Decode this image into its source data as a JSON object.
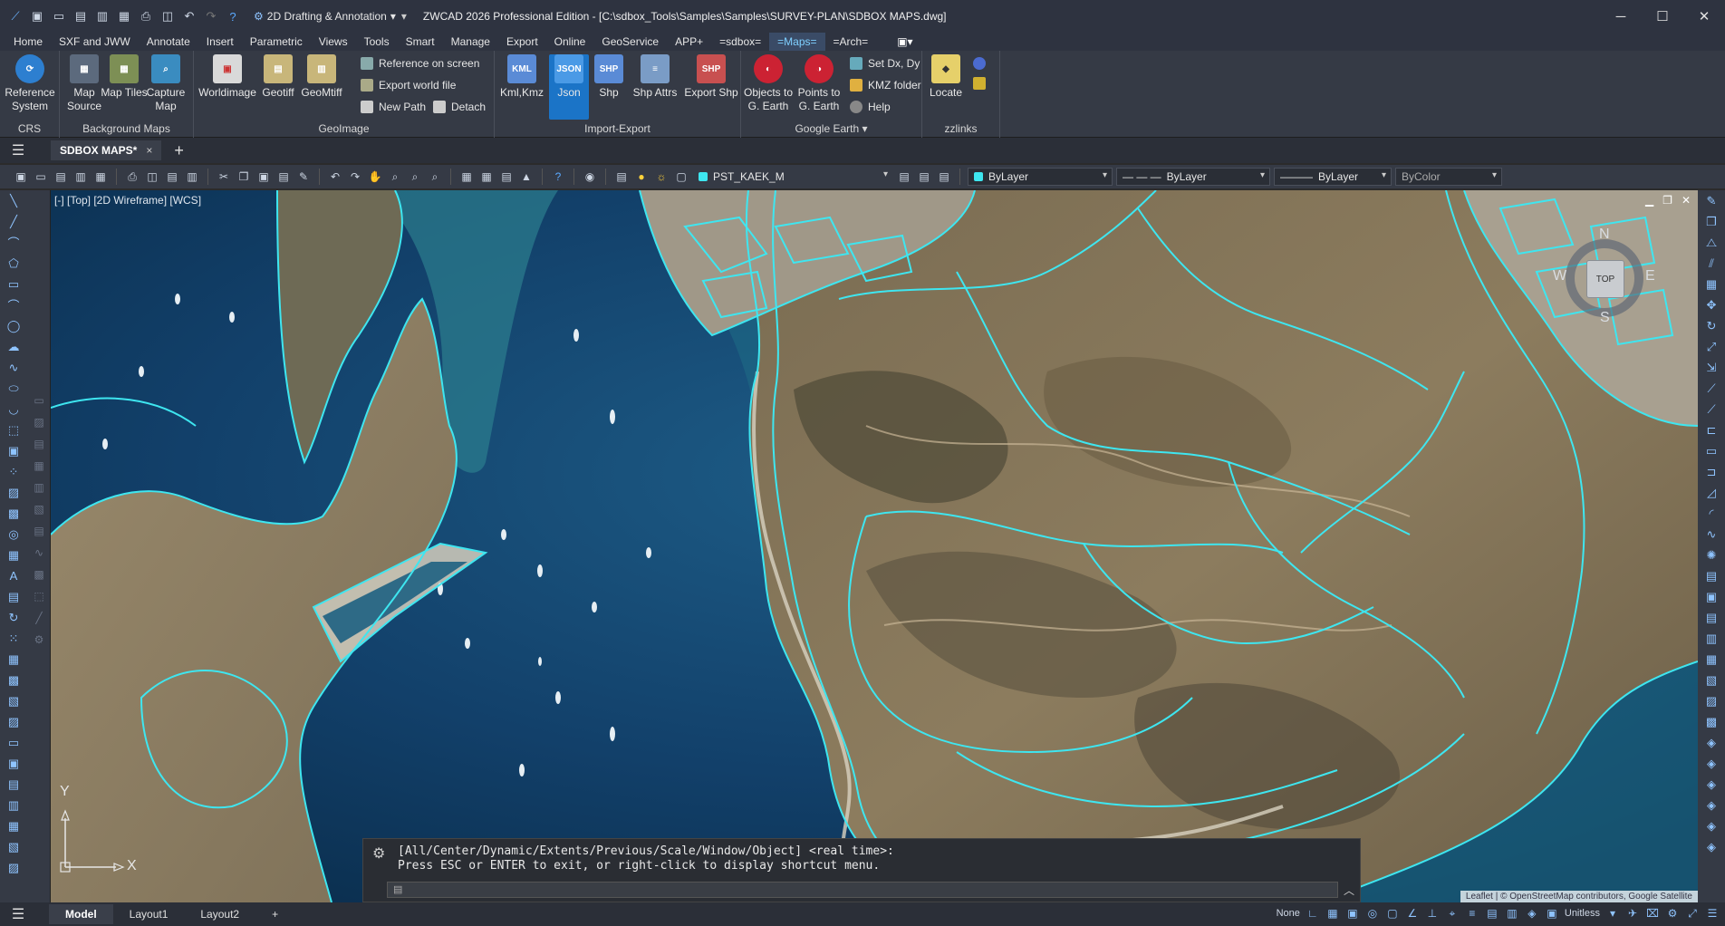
{
  "app": {
    "title": "ZWCAD 2026 Professional Edition - [C:\\sdbox_Tools\\Samples\\Samples\\SURVEY-PLAN\\SDBOX MAPS.dwg]",
    "workspace": "2D Drafting & Annotation",
    "window_buttons": [
      "─",
      "☐",
      "✕"
    ]
  },
  "ribbon_tabs": [
    "Home",
    "SXF and JWW",
    "Annotate",
    "Insert",
    "Parametric",
    "Views",
    "Tools",
    "Smart",
    "Manage",
    "Export",
    "Online",
    "GeoService",
    "APP+",
    "=sdbox=",
    "=Maps=",
    "=Arch="
  ],
  "active_ribbon_tab": "=Maps=",
  "ribbon": {
    "crs": {
      "title": "CRS",
      "btn_reference_system": "Reference System"
    },
    "background_maps": {
      "title": "Background Maps",
      "btn_map_source": "Map Source",
      "btn_map_tiles": "Map Tiles",
      "btn_capture_map": "Capture Map"
    },
    "geoimage": {
      "title": "GeoImage",
      "btn_worldimage": "Worldimage",
      "btn_geotiff": "Geotiff",
      "btn_geomtiff": "GeoMtiff",
      "small_reference_on_screen": "Reference on screen",
      "small_export_world_file": "Export world file",
      "small_new_path": "New Path",
      "small_detach": "Detach"
    },
    "import_export": {
      "title": "Import-Export",
      "btn_kml": "Kml,Kmz",
      "btn_json": "Json",
      "btn_shp": "Shp",
      "btn_shp_attrs": "Shp Attrs",
      "btn_export_shp": "Export Shp",
      "ico_kml": "KML",
      "ico_json": "JSON",
      "ico_shp": "SHP",
      "ico_shp2": "SHP"
    },
    "google_earth": {
      "title": "Google Earth",
      "btn_objects": "Objects to G. Earth",
      "btn_points": "Points to G. Earth",
      "small_set_dx": "Set Dx, Dy",
      "small_kmz_folder": "KMZ folder",
      "small_help": "Help"
    },
    "zzlinks": {
      "title": "zzlinks",
      "btn_locate": "Locate"
    }
  },
  "doc_tabs": {
    "active": "SDBOX MAPS*",
    "close": "×",
    "add": "+"
  },
  "layer_toolbar": {
    "layer_name": "PST_KAEK_M",
    "color": "ByLayer",
    "linetype": "ByLayer",
    "lineweight": "ByLayer",
    "plotstyle": "ByColor"
  },
  "viewport": {
    "label": "[-] [Top] [2D Wireframe] [WCS]",
    "viewcube": {
      "top": "TOP",
      "n": "N",
      "s": "S",
      "e": "E",
      "w": "W"
    },
    "ucs_x": "X",
    "ucs_y": "Y",
    "attribution": "Leaflet | © OpenStreetMap contributors, Google Satellite"
  },
  "command": {
    "line1": "[All/Center/Dynamic/Extents/Previous/Scale/Window/Object] <real time>:",
    "line2": "Press ESC or ENTER to exit, or right-click to display shortcut menu."
  },
  "status": {
    "tabs": [
      "Model",
      "Layout1",
      "Layout2"
    ],
    "active": "Model",
    "snap": "None",
    "units": "Unitless"
  },
  "colors": {
    "accent": "#1b74c7",
    "boundary": "#3ee6f0",
    "sea_deep": "#0f3a5e",
    "land": "#8a7a5e"
  }
}
